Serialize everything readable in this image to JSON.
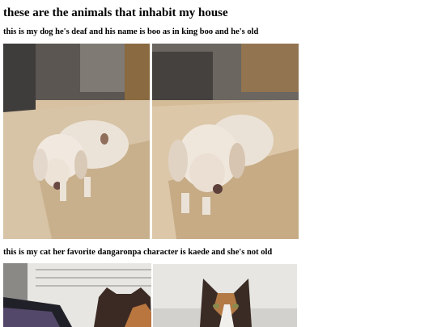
{
  "page": {
    "title": "these are the animals that inhabit my house"
  },
  "sections": [
    {
      "caption": "this is my dog he's deaf and his name is boo as in king boo and he's old",
      "photos": [
        {
          "subject": "white dog standing on wooden floor, photo 1"
        },
        {
          "subject": "white dog standing on wooden floor, photo 2"
        }
      ]
    },
    {
      "caption": "this is my cat her favorite dangaronpa character is kaede and she's not old",
      "photos": [
        {
          "subject": "tortoiseshell cat near window blinds and monitor"
        },
        {
          "subject": "calico cat portrait"
        }
      ]
    }
  ],
  "colors": {
    "floor": "#d9c3a3",
    "dog_fur": "#efe7de",
    "cat_dark": "#3a2a22",
    "cat_orange": "#b8743c"
  }
}
